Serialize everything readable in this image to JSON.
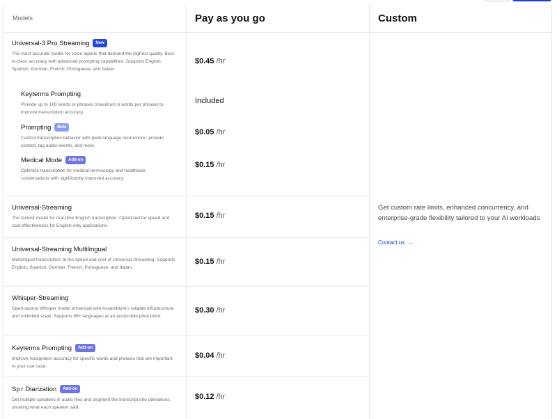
{
  "headers": {
    "models": "Models",
    "payg": "Pay as you go",
    "custom": "Custom"
  },
  "rows": [
    {
      "title": "Universal-3 Pro Streaming",
      "badge": "New",
      "desc": "The most accurate model for voice agents that demand the highest quality. Best-in-class accuracy with advanced prompting capabilities. Supports English, Spanish, German, French, Portuguese, and Italian.",
      "price": "$0.45",
      "unit": "/hr"
    },
    {
      "title": "Keyterms Prompting",
      "badge": "",
      "desc": "Provide up to 100 words or phrases (maximum 6 words per phrase) to improve transcription accuracy.",
      "price": "Included",
      "unit": ""
    },
    {
      "title": "Prompting",
      "badge": "Beta",
      "desc": "Control transcription behavior with plain language instructions: provide context, tag audio events, and more.",
      "price": "$0.05",
      "unit": "/hr"
    },
    {
      "title": "Medical Mode",
      "badge": "Add-on",
      "desc": "Optimize transcription for medical terminology and healthcare conversations with significantly improved accuracy.",
      "price": "$0.15",
      "unit": "/hr"
    },
    {
      "title": "Universal-Streaming",
      "badge": "",
      "desc": "The fastest model for real-time English transcription. Optimized for speed and cost-effectiveness for English-only applications.",
      "price": "$0.15",
      "unit": "/hr"
    },
    {
      "title": "Universal-Streaming Multilingual",
      "badge": "",
      "desc": "Multilingual transcription at the speed and cost of Universal-Streaming. Supports English, Spanish, German, French, Portuguese, and Italian.",
      "price": "$0.15",
      "unit": "/hr"
    },
    {
      "title": "Whisper-Streaming",
      "badge": "",
      "desc": "Open-source Whisper model enhanced with AssemblyAI's reliable infrastructure and unlimited scale. Supports 99+ languages at an accessible price point.",
      "price": "$0.30",
      "unit": "/hr"
    },
    {
      "title": "Keyterms Prompting",
      "badge": "Add-on",
      "desc": "Improve recognition accuracy for specific words and phrases that are important to your use case.",
      "price": "$0.04",
      "unit": "/hr"
    },
    {
      "title": "Sp r Diarization",
      "badge": "Add-on",
      "desc": "Det multiple speakers in audio files and segment the transcript into utterances, showing what each speaker said.",
      "price": "$0.12",
      "unit": "/hr"
    }
  ],
  "custom": {
    "desc": "Get custom rate limits, enhanced concurrency, and enterprise-grade flexibility tailored to your AI workloads",
    "link": "Contact us",
    "link_icon": "arrow-right-icon"
  },
  "colors": {
    "accent": "#1f3fd1",
    "badge_new": "#2447d9",
    "badge_beta": "#8b9ef0",
    "badge_addon": "#6e75e0"
  }
}
